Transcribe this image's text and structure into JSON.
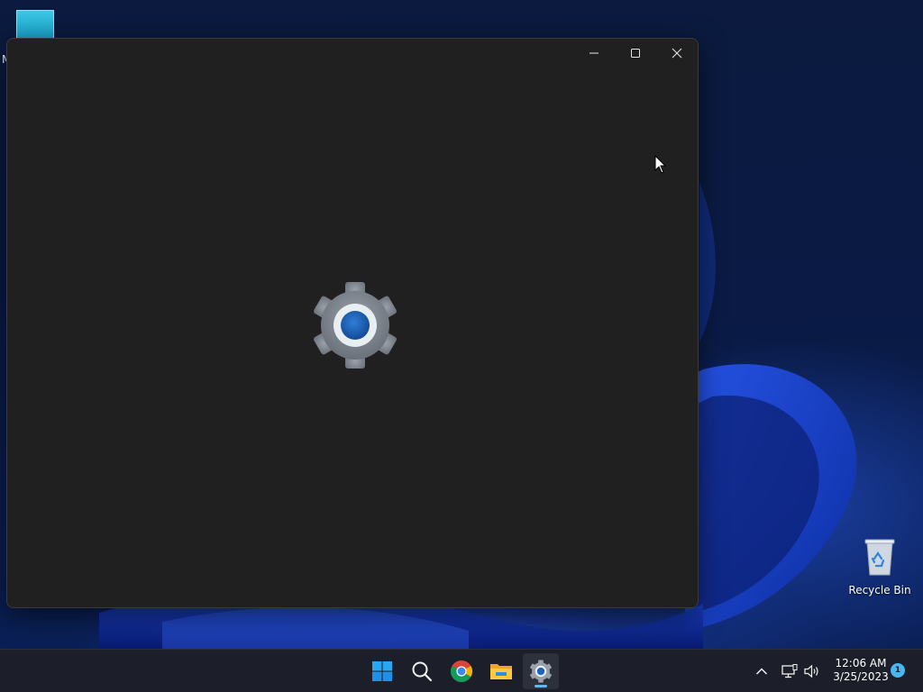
{
  "desktop": {
    "top_icon_label": "M",
    "recycle_bin_label": "Recycle Bin"
  },
  "window": {
    "app": "Settings",
    "controls": [
      "minimize-icon",
      "maximize-icon",
      "close-icon"
    ],
    "splash_icon": "gear-icon"
  },
  "taskbar": {
    "pinned": [
      "windows-start-icon",
      "search-icon",
      "chrome-icon",
      "file-explorer-icon",
      "settings-gear-icon"
    ],
    "active": "settings-gear-icon",
    "tray": [
      "chevron-up-icon",
      "network-icon",
      "volume-icon"
    ],
    "clock": {
      "time": "12:06 AM",
      "date": "3/25/2023"
    },
    "notification_count": "1"
  },
  "colors": {
    "window_bg": "#202020",
    "taskbar_bg": "#1c1f29",
    "accent": "#1b64b8",
    "start_blue": "#1e90e8"
  }
}
